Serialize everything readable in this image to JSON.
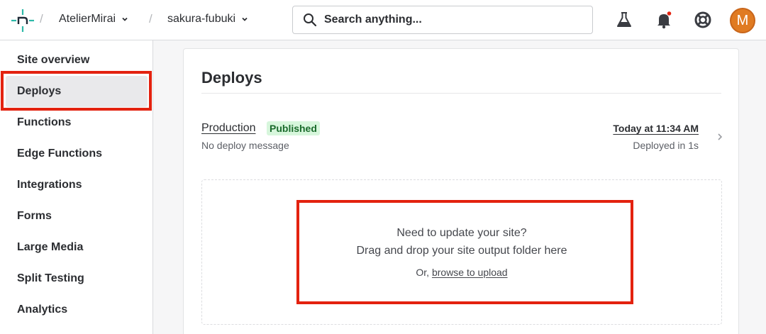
{
  "topbar": {
    "team": "AtelierMirai",
    "site": "sakura-fubuki",
    "search_placeholder": "Search anything..."
  },
  "icons": {
    "logo": "netlify-logo-icon",
    "labs": "flask-icon",
    "notifications": "bell-icon",
    "support": "lifebuoy-icon"
  },
  "user": {
    "avatar_initial": "M",
    "avatar_color": "#e07b22"
  },
  "sidebar": {
    "items": [
      {
        "label": "Site overview"
      },
      {
        "label": "Deploys",
        "active": true
      },
      {
        "label": "Functions"
      },
      {
        "label": "Edge Functions"
      },
      {
        "label": "Integrations"
      },
      {
        "label": "Forms"
      },
      {
        "label": "Large Media"
      },
      {
        "label": "Split Testing"
      },
      {
        "label": "Analytics"
      }
    ]
  },
  "main": {
    "title": "Deploys",
    "production": {
      "label": "Production",
      "badge": "Published",
      "message": "No deploy message",
      "time": "Today at 11:34 AM",
      "duration": "Deployed in 1s"
    },
    "dropzone": {
      "line1": "Need to update your site?",
      "line2": "Drag and drop your site output folder here",
      "or_prefix": "Or,",
      "link": "browse to upload"
    }
  },
  "colors": {
    "highlight": "#e3220f",
    "badge_bg": "#d7f6dc",
    "badge_text": "#1b6b2c",
    "logo_teal": "#2db9a8"
  }
}
